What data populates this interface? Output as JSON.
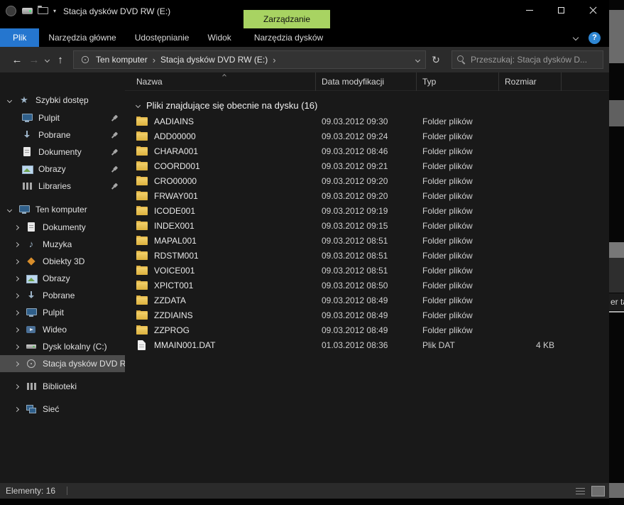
{
  "window": {
    "title": "Stacja dysków DVD RW (E:)"
  },
  "ribbon": {
    "contextual_tab": "Zarządzanie",
    "tabs": [
      "Plik",
      "Narzędzia główne",
      "Udostępnianie",
      "Widok",
      "Narzędzia dysków"
    ],
    "help": "?"
  },
  "icons": {
    "back": "←",
    "forward": "→",
    "up": "↑",
    "refresh": "↻",
    "dropdown": "▾",
    "breadcrumb_separator": "›",
    "music": "♪",
    "star": "★"
  },
  "address_bar": {
    "breadcrumb": [
      "Ten komputer",
      "Stacja dysków DVD RW (E:)"
    ],
    "search_placeholder": "Przeszukaj: Stacja dysków D..."
  },
  "sidebar": {
    "quick_access": {
      "label": "Szybki dostęp",
      "items": [
        "Pulpit",
        "Pobrane",
        "Dokumenty",
        "Obrazy",
        "Libraries"
      ]
    },
    "this_pc": {
      "label": "Ten komputer",
      "items": [
        "Dokumenty",
        "Muzyka",
        "Obiekty 3D",
        "Obrazy",
        "Pobrane",
        "Pulpit",
        "Wideo",
        "Dysk lokalny (C:)",
        "Stacja dysków DVD RW"
      ]
    },
    "libraries_label": "Biblioteki",
    "network_label": "Sieć"
  },
  "file_list": {
    "columns": [
      "Nazwa",
      "Data modyfikacji",
      "Typ",
      "Rozmiar"
    ],
    "group_header": "Pliki znajdujące się obecnie na dysku (16)",
    "items": [
      {
        "name": "AADIAINS",
        "modified": "09.03.2012 09:30",
        "type": "Folder plików",
        "size": ""
      },
      {
        "name": "ADD00000",
        "modified": "09.03.2012 09:24",
        "type": "Folder plików",
        "size": ""
      },
      {
        "name": "CHARA001",
        "modified": "09.03.2012 08:46",
        "type": "Folder plików",
        "size": ""
      },
      {
        "name": "COORD001",
        "modified": "09.03.2012 09:21",
        "type": "Folder plików",
        "size": ""
      },
      {
        "name": "CRO00000",
        "modified": "09.03.2012 09:20",
        "type": "Folder plików",
        "size": ""
      },
      {
        "name": "FRWAY001",
        "modified": "09.03.2012 09:20",
        "type": "Folder plików",
        "size": ""
      },
      {
        "name": "ICODE001",
        "modified": "09.03.2012 09:19",
        "type": "Folder plików",
        "size": ""
      },
      {
        "name": "INDEX001",
        "modified": "09.03.2012 09:15",
        "type": "Folder plików",
        "size": ""
      },
      {
        "name": "MAPAL001",
        "modified": "09.03.2012 08:51",
        "type": "Folder plików",
        "size": ""
      },
      {
        "name": "RDSTM001",
        "modified": "09.03.2012 08:51",
        "type": "Folder plików",
        "size": ""
      },
      {
        "name": "VOICE001",
        "modified": "09.03.2012 08:51",
        "type": "Folder plików",
        "size": ""
      },
      {
        "name": "XPICT001",
        "modified": "09.03.2012 08:50",
        "type": "Folder plików",
        "size": ""
      },
      {
        "name": "ZZDATA",
        "modified": "09.03.2012 08:49",
        "type": "Folder plików",
        "size": ""
      },
      {
        "name": "ZZDIAINS",
        "modified": "09.03.2012 08:49",
        "type": "Folder plików",
        "size": ""
      },
      {
        "name": "ZZPROG",
        "modified": "09.03.2012 08:49",
        "type": "Folder plików",
        "size": ""
      },
      {
        "name": "MMAIN001.DAT",
        "modified": "01.03.2012 08:36",
        "type": "Plik DAT",
        "size": "4 KB"
      }
    ]
  },
  "status_bar": {
    "items_label": "Elementy: 16"
  },
  "background_window": {
    "fragment": "er ta"
  }
}
